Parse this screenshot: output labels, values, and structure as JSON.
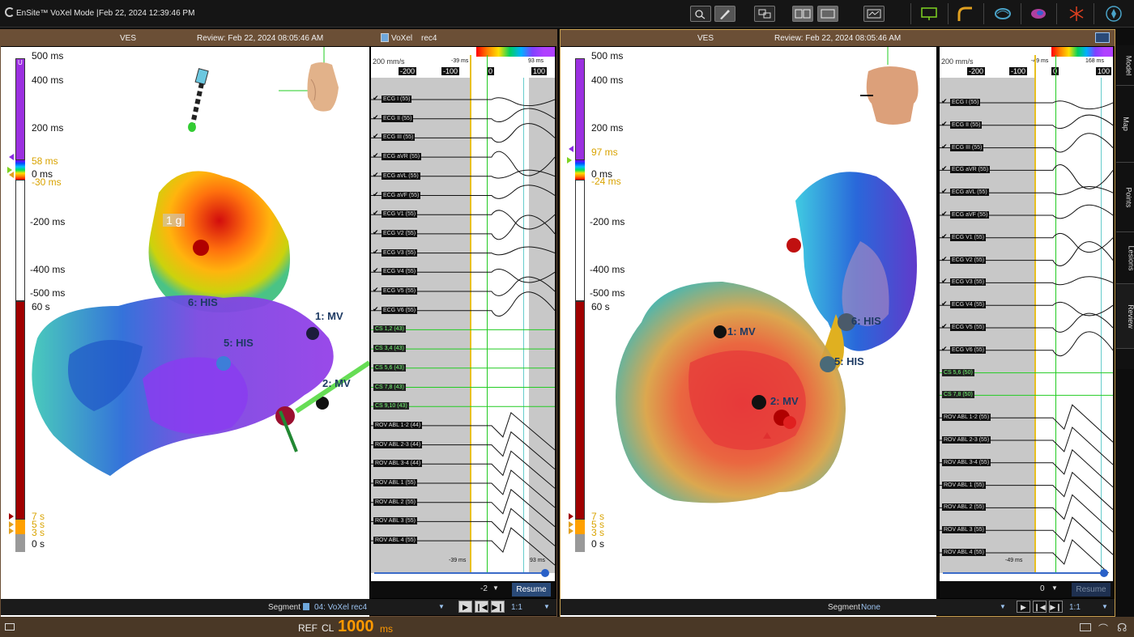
{
  "app": {
    "title": "EnSite™ VoXel Mode |",
    "datetime": "Feb 22, 2024 12:39:46 PM"
  },
  "toolbar": {
    "icons": [
      "zoom-tool-icon",
      "annotate-tool-icon",
      "layout-icon",
      "split-view-icon",
      "single-view-icon",
      "review-icon",
      "monitor-icon",
      "catheter-icon",
      "map-icon",
      "surface-icon",
      "ablation-icon",
      "compass-icon"
    ]
  },
  "left_panel": {
    "header": {
      "left": "VES",
      "center": "Review: Feb 22, 2024 08:05:46 AM",
      "right_label": "VoXel",
      "right_value": "rec4"
    },
    "scale": {
      "labels": [
        "500 ms",
        "400 ms",
        "200 ms",
        "58 ms",
        "0 ms",
        "-30 ms",
        "-200 ms",
        "-400 ms",
        "-500 ms",
        "60 s",
        "7 s",
        "5 s",
        "3 s",
        "0 s"
      ],
      "small_marker": "U"
    },
    "map_labels": [
      "6: HIS",
      "1: MV",
      "5: HIS",
      "2: MV"
    ],
    "faint_label": "1 g",
    "egm": {
      "speed": "200 mm/s",
      "top_left": "-39 ms",
      "top_right": "93 ms",
      "ticks": [
        "-200",
        "-100",
        "0",
        "100"
      ],
      "channels": [
        "ECG I (55)",
        "ECG II (55)",
        "ECG III (55)",
        "ECG aVR (55)",
        "ECG aVL (55)",
        "ECG aVF (55)",
        "ECG V1 (55)",
        "ECG V2 (55)",
        "ECG V3 (55)",
        "ECG V4 (55)",
        "ECG V5 (55)",
        "ECG V6 (55)",
        "CS 1,2 (43)",
        "CS 3,4 (43)",
        "CS 5,6 (43)",
        "CS 7,8 (43)",
        "CS 9,10 (43)",
        "ROV ABL 1-2 (44)",
        "ROV ABL 2-3 (44)",
        "ROV ABL 3-4 (44)",
        "ROV ABL 1 (55)",
        "ROV ABL 2 (55)",
        "ROV ABL 3 (55)",
        "ROV ABL 4 (55)"
      ],
      "bottom_left": "-39 ms",
      "bottom_right": "93 ms",
      "value": "-2",
      "resume": "Resume"
    },
    "segment": {
      "label": "Segment",
      "value": "04: VoXel rec4",
      "ratio": "1:1"
    }
  },
  "right_panel": {
    "header": {
      "left": "VES",
      "center": "Review: Feb 22, 2024 08:05:46 AM"
    },
    "scale": {
      "labels": [
        "500 ms",
        "400 ms",
        "200 ms",
        "97 ms",
        "0 ms",
        "-24 ms",
        "-200 ms",
        "-400 ms",
        "-500 ms",
        "60 s",
        "7 s",
        "5 s",
        "3 s",
        "0 s"
      ]
    },
    "map_labels": [
      "1: MV",
      "2: MV",
      "6: HIS",
      "5: HIS"
    ],
    "egm": {
      "speed": "200 mm/s",
      "top_left": "-49 ms",
      "top_right": "168 ms",
      "ticks": [
        "-200",
        "-100",
        "0",
        "100"
      ],
      "channels": [
        "ECG I (55)",
        "ECG II (55)",
        "ECG III (55)",
        "ECG aVR (55)",
        "ECG aVL (55)",
        "ECG aVF (55)",
        "ECG V1 (55)",
        "ECG V2 (55)",
        "ECG V3 (55)",
        "ECG V4 (55)",
        "ECG V5 (55)",
        "ECG V6 (55)",
        "CS 5,6 (50)",
        "CS 7,8 (50)",
        "ROV ABL 1-2 (55)",
        "ROV ABL 2-3 (55)",
        "ROV ABL 3-4 (55)",
        "ROV ABL 1 (55)",
        "ROV ABL 2 (55)",
        "ROV ABL 3 (55)",
        "ROV ABL 4 (55)"
      ],
      "bottom_left": "-49 ms",
      "value": "0",
      "resume": "Resume"
    },
    "segment": {
      "label": "Segment",
      "value": "None",
      "ratio": "1:1"
    }
  },
  "side_tabs": [
    "Model",
    "Map",
    "Points",
    "Lesions",
    "Review"
  ],
  "status": {
    "ref": "REF",
    "cl": "CL",
    "cl_value": "1000",
    "unit": "ms"
  },
  "colors": {
    "header": "#6b4f36",
    "status": "#4a3826",
    "accent_orange": "#ff9900",
    "label_yellow": "#d9a300"
  }
}
